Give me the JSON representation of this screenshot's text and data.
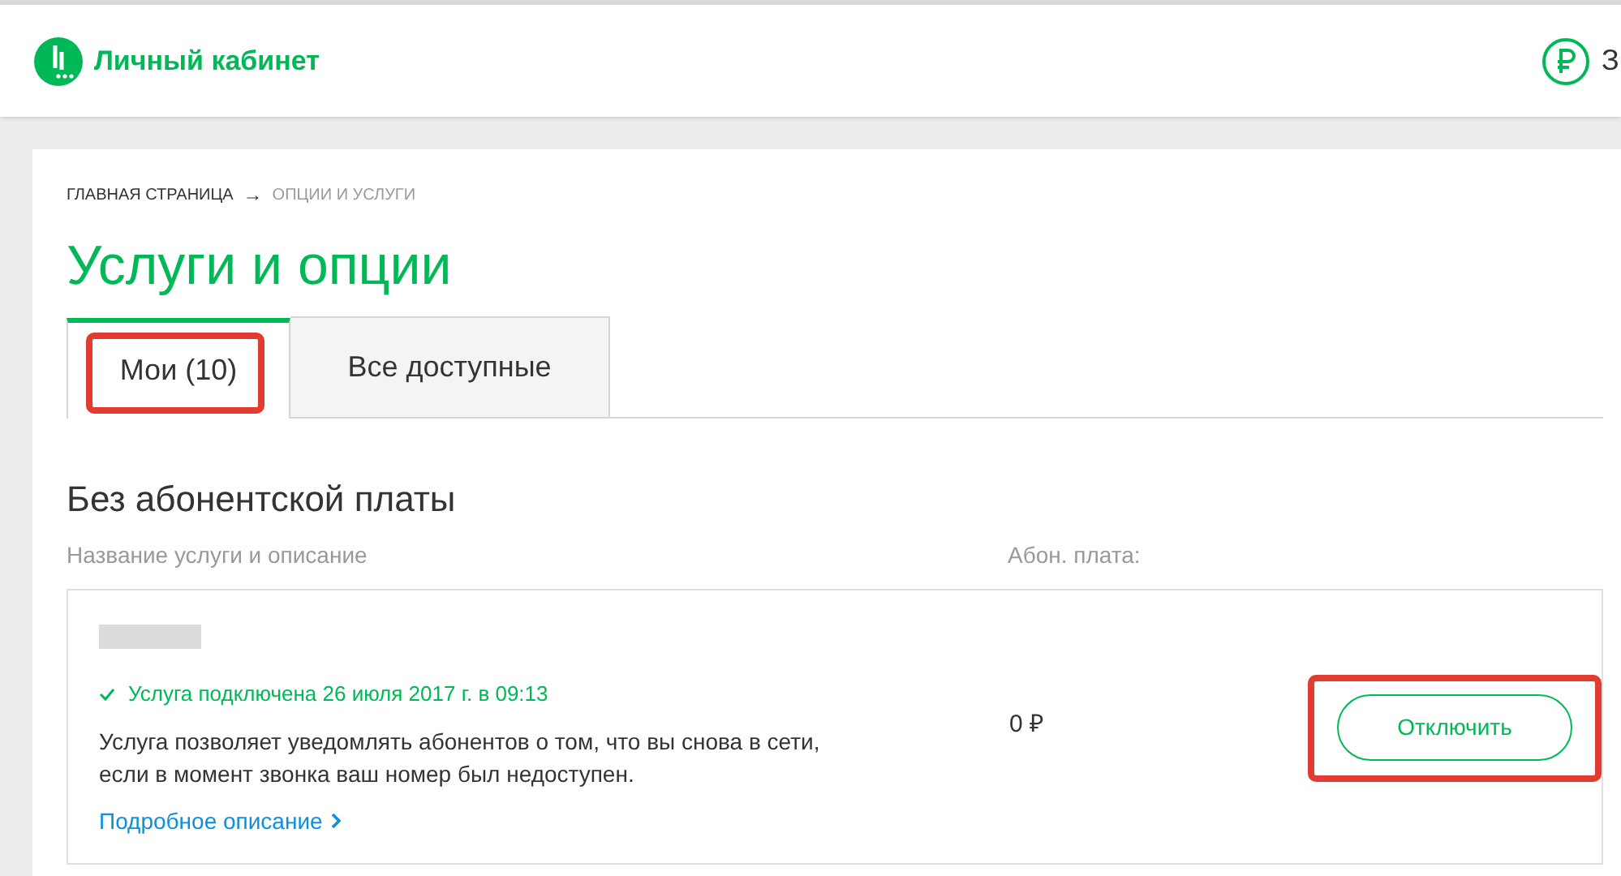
{
  "header": {
    "logo_text": "Личный кабинет",
    "balance_text": "З"
  },
  "breadcrumbs": [
    {
      "label": "ГЛАВНАЯ СТРАНИЦА",
      "current": false
    },
    {
      "label": "ОПЦИИ И УСЛУГИ",
      "current": true
    }
  ],
  "breadcrumb_separator": "→",
  "title": "Услуги и опции",
  "tabs": [
    {
      "label": "Мои (10)",
      "selected": true,
      "highlighted": true
    },
    {
      "label": "Все доступные",
      "selected": false,
      "highlighted": false
    }
  ],
  "section_title": "Без абонентской платы",
  "columns": [
    "Название услуги и описание",
    "Абон. плата:"
  ],
  "services": [
    {
      "name_redacted": true,
      "status": "Услуга подключена 26 июля 2017 г. в 09:13",
      "description": "Услуга позволяет уведомлять абонентов о том, что вы снова в сети, если в момент звонка ваш номер был недоступен.",
      "link": "Подробное описание",
      "price": "0 ₽",
      "button": {
        "label": "Отключить",
        "highlighted": true
      }
    }
  ]
}
